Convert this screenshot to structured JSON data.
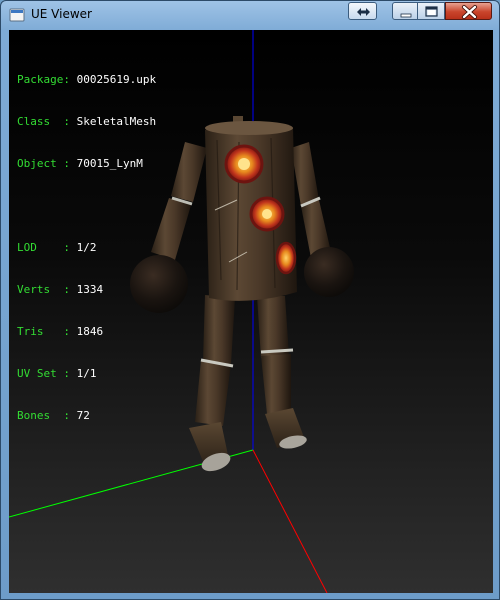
{
  "window": {
    "title": "UE Viewer",
    "controls": {
      "fullscreen_icon": "double-arrow-icon",
      "minimize_icon": "minimize-icon",
      "maximize_icon": "maximize-icon",
      "close_icon": "close-x-icon"
    }
  },
  "viewer": {
    "background_top": "#000000",
    "background_bottom": "#303030",
    "axis_colors": {
      "x": "#ff0000",
      "y": "#00ff00",
      "z": "#0000ff"
    },
    "info": {
      "package": {
        "label": "Package:",
        "value": "00025619.upk"
      },
      "class": {
        "label": "Class  :",
        "value": "SkeletalMesh"
      },
      "object": {
        "label": "Object :",
        "value": "70015_LynM"
      },
      "lod": {
        "label": "LOD    :",
        "value": "1/2"
      },
      "verts": {
        "label": "Verts  :",
        "value": "1334"
      },
      "tris": {
        "label": "Tris   :",
        "value": "1846"
      },
      "uvset": {
        "label": "UV Set :",
        "value": "1/1"
      },
      "bones": {
        "label": "Bones  :",
        "value": "72"
      }
    }
  }
}
